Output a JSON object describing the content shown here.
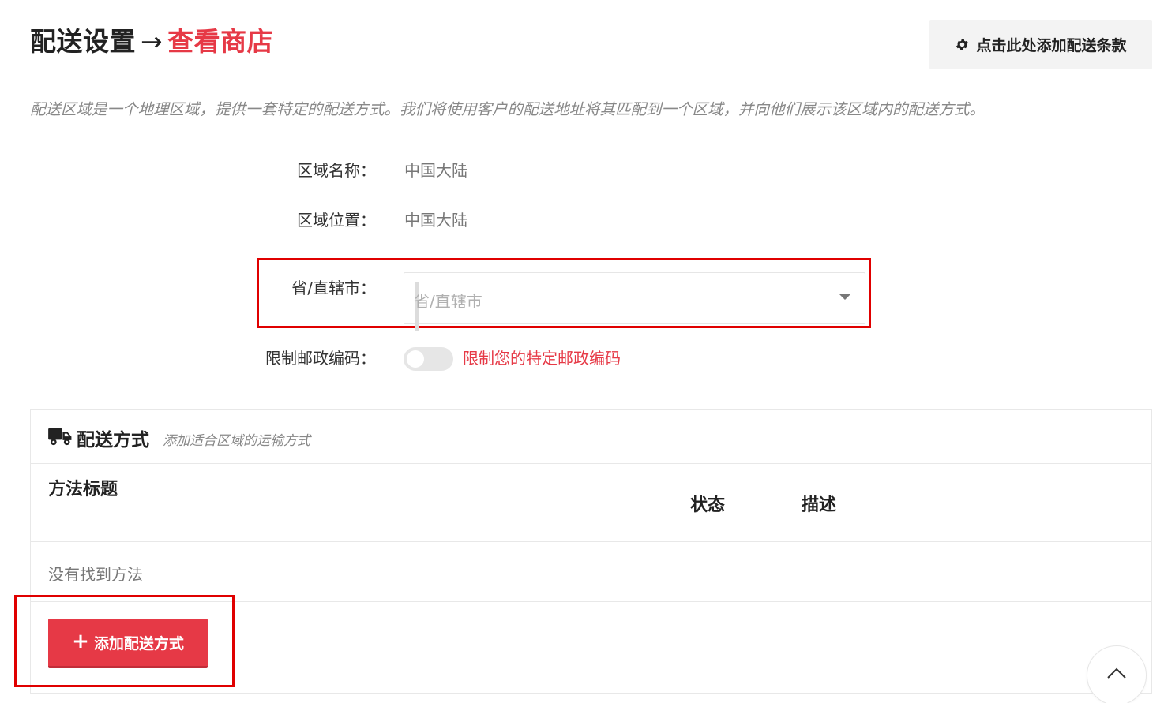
{
  "header": {
    "title": "配送设置",
    "arrow": "→",
    "view_store_link": "查看商店",
    "add_terms_button": "点击此处添加配送条款",
    "add_terms_icon": "gear-icon"
  },
  "intro": "配送区域是一个地理区域，提供一套特定的配送方式。我们将使用客户的配送地址将其匹配到一个区域，并向他们展示该区域内的配送方式。",
  "form": {
    "zone_name_label": "区域名称：",
    "zone_name_value": "中国大陆",
    "zone_location_label": "区域位置：",
    "zone_location_value": "中国大陆",
    "province_label": "省/直辖市：",
    "province_placeholder": "省/直辖市",
    "postcode_label": "限制邮政编码：",
    "postcode_toggle_text": "限制您的特定邮政编码",
    "postcode_toggle_on": false
  },
  "shipping_methods": {
    "title": "配送方式",
    "subtitle": "添加适合区域的运输方式",
    "icon": "truck-icon",
    "columns": {
      "method_title": "方法标题",
      "status": "状态",
      "description": "描述"
    },
    "empty_text": "没有找到方法",
    "add_button": "添加配送方式",
    "add_button_icon": "plus-icon"
  },
  "scroll_top_icon": "chevron-up-icon",
  "colors": {
    "accent": "#e63946",
    "highlight": "#e00000"
  }
}
